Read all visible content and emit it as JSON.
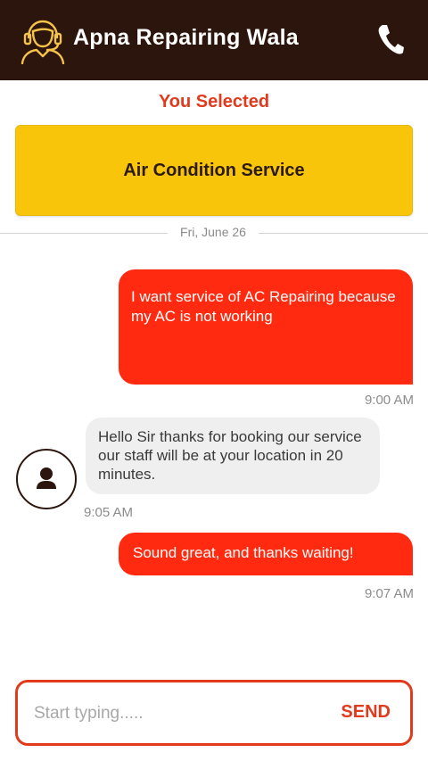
{
  "header": {
    "title": "Apna Repairing Wala",
    "icons": {
      "left": "customer-support-agent-icon",
      "right": "phone-icon"
    },
    "background": "#2b150c"
  },
  "selection": {
    "label": "You Selected",
    "service": "Air Condition Service",
    "card_color": "#f8c50a"
  },
  "date_separator": "Fri, June 26",
  "messages": [
    {
      "direction": "outgoing",
      "text": "I want service of AC Repairing because my AC is not working",
      "time": "9:00 AM"
    },
    {
      "direction": "incoming",
      "text": "Hello Sir thanks for booking our service our staff will be at your location in 20 minutes.",
      "time": "9:05 AM",
      "avatar_icon": "user-avatar-icon"
    },
    {
      "direction": "outgoing",
      "text": "Sound great, and thanks waiting!",
      "time": "9:07 AM"
    }
  ],
  "composer": {
    "placeholder": "Start typing.....",
    "value": "",
    "send_label": "SEND"
  },
  "colors": {
    "accent": "#e23a1c",
    "outgoing_bubble": "#ff2a0f",
    "incoming_bubble": "#efefef"
  }
}
